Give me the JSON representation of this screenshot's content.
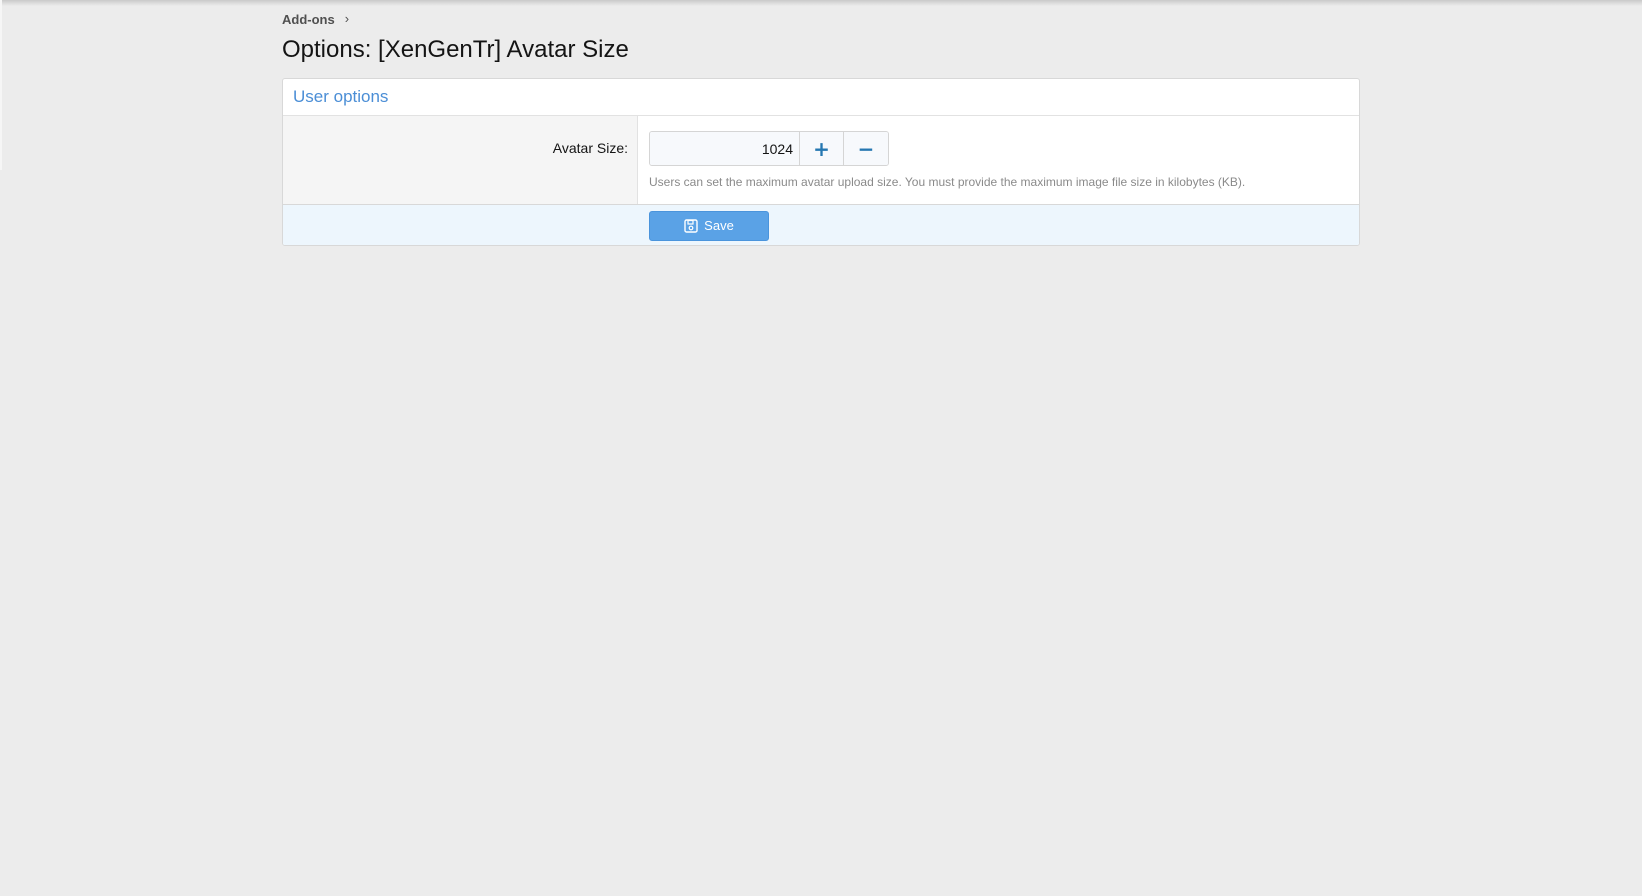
{
  "breadcrumb": {
    "items": [
      {
        "label": "Add-ons"
      }
    ],
    "separator_icon": "chevron-right-icon"
  },
  "page": {
    "title": "Options: [XenGenTr] Avatar Size"
  },
  "options_block": {
    "header": "User options",
    "fields": [
      {
        "label": "Avatar Size:",
        "value": "1024",
        "increment_label": "+",
        "decrement_label": "−",
        "hint": "Users can set the maximum avatar upload size. You must provide the maximum image file size in kilobytes (KB)."
      }
    ],
    "submit": {
      "label": "Save",
      "icon": "save-icon"
    }
  },
  "colors": {
    "background": "#ececec",
    "accent_link": "#4b8ed6",
    "spin_button_text": "#2577b1",
    "save_button": "#5aa2e6",
    "submit_row_background": "#edf6fd",
    "label_column_background": "#f5f5f5"
  }
}
